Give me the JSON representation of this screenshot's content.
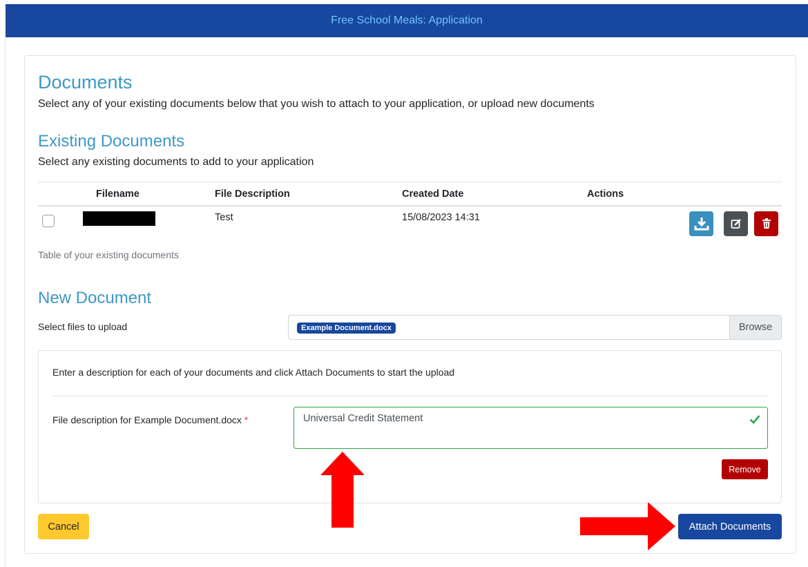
{
  "header": {
    "title": "Free School Meals: Application"
  },
  "documents": {
    "title": "Documents",
    "subtitle": "Select any of your existing documents below that you wish to attach to your application, or upload new documents"
  },
  "existing": {
    "title": "Existing Documents",
    "subtitle": "Select any existing documents to add to your application",
    "columns": [
      "Filename",
      "File Description",
      "Created Date",
      "Actions"
    ],
    "rows": [
      {
        "filename": "",
        "description": "Test",
        "created": "15/08/2023 14:31"
      }
    ],
    "caption": "Table of your existing documents"
  },
  "new_document": {
    "title": "New Document",
    "select_label": "Select files to upload",
    "selected_file": "Example Document.docx",
    "browse_label": "Browse",
    "instructions": "Enter a description for each of your documents and click Attach Documents to start the upload",
    "field_label": "File description for Example Document.docx",
    "required_mark": "*",
    "field_value": "Universal Credit Statement",
    "remove_label": "Remove"
  },
  "footer": {
    "cancel_label": "Cancel",
    "attach_label": "Attach Documents"
  },
  "colors": {
    "header_bg": "#17479e",
    "heading": "#3d98c5",
    "download": "#3a8fbf",
    "edit": "#4a5056",
    "delete": "#b30000",
    "valid": "#28a745",
    "annotation_arrow": "#ff0000"
  }
}
